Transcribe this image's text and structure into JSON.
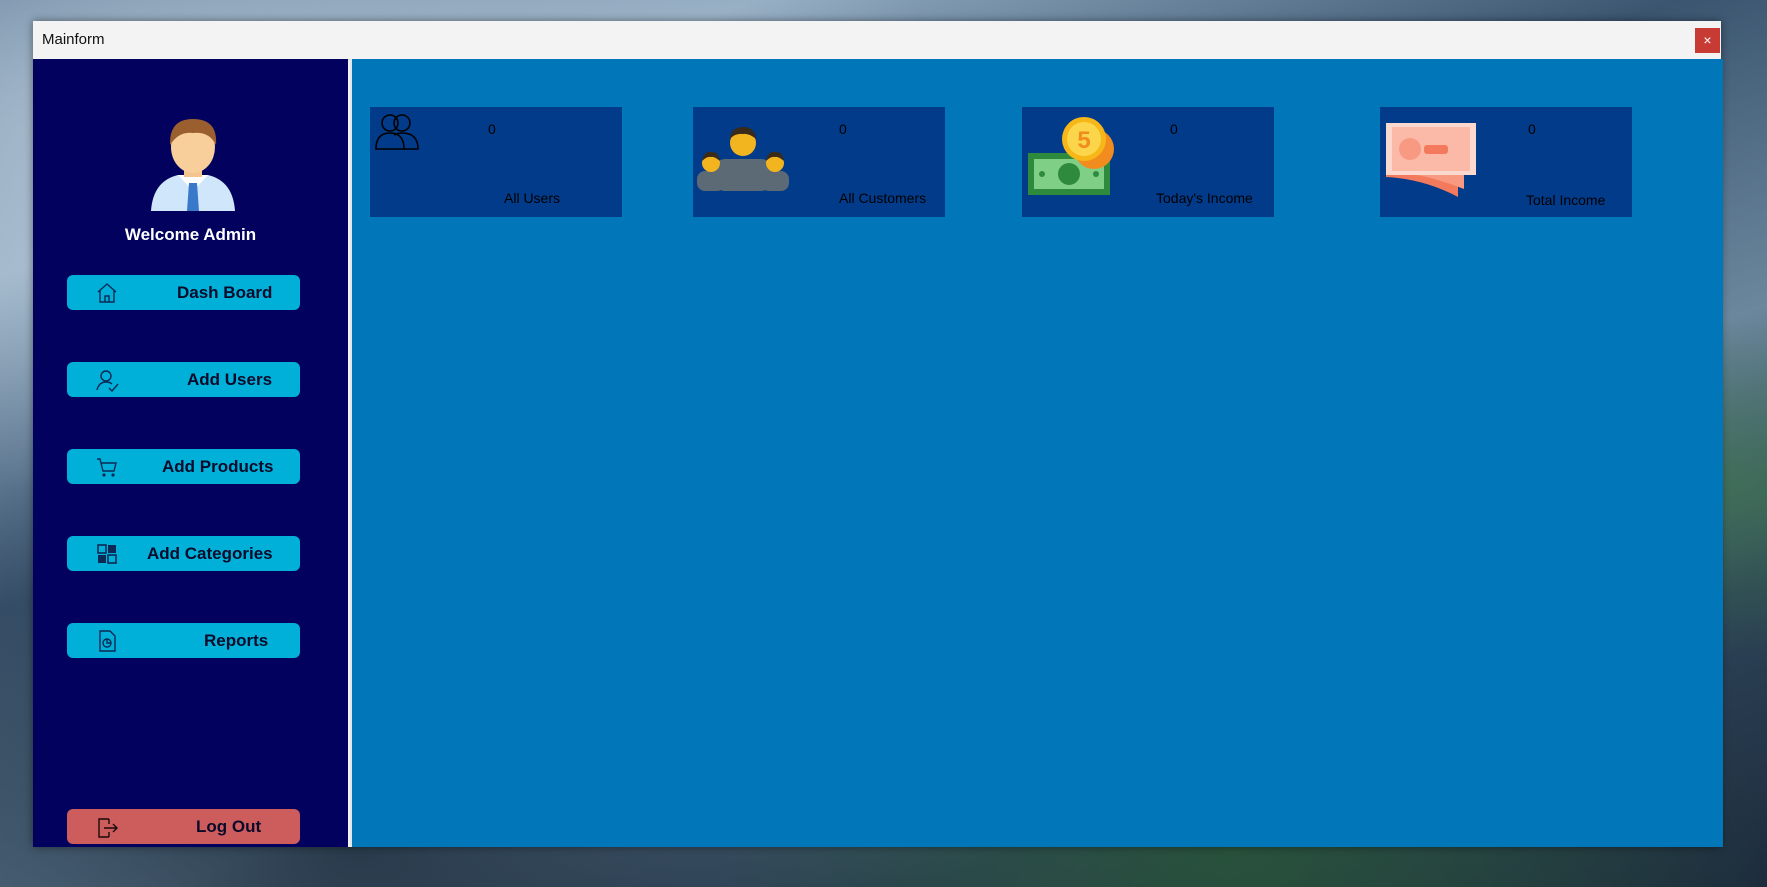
{
  "window": {
    "title": "Mainform",
    "close_label": "×"
  },
  "sidebar": {
    "welcome": "Welcome Admin",
    "items": [
      {
        "label": "Dash Board",
        "icon": "home-icon"
      },
      {
        "label": "Add Users",
        "icon": "user-icon"
      },
      {
        "label": "Add Products",
        "icon": "cart-icon"
      },
      {
        "label": "Add Categories",
        "icon": "categories-icon"
      },
      {
        "label": "Reports",
        "icon": "report-icon"
      }
    ],
    "logout": {
      "label": "Log Out",
      "icon": "logout-icon"
    }
  },
  "cards": [
    {
      "value": "0",
      "caption": "All Users",
      "icon": "users-outline-icon"
    },
    {
      "value": "0",
      "caption": "All Customers",
      "icon": "customers-icon"
    },
    {
      "value": "0",
      "caption": "Today's Income",
      "icon": "money-coins-icon"
    },
    {
      "value": "0",
      "caption": "Total Income",
      "icon": "bills-icon"
    }
  ],
  "colors": {
    "sidebar": "#02025e",
    "content": "#0176b8",
    "nav_button": "#01b0d8",
    "logout_button": "#cd5c5c",
    "card": "#023b8a"
  }
}
